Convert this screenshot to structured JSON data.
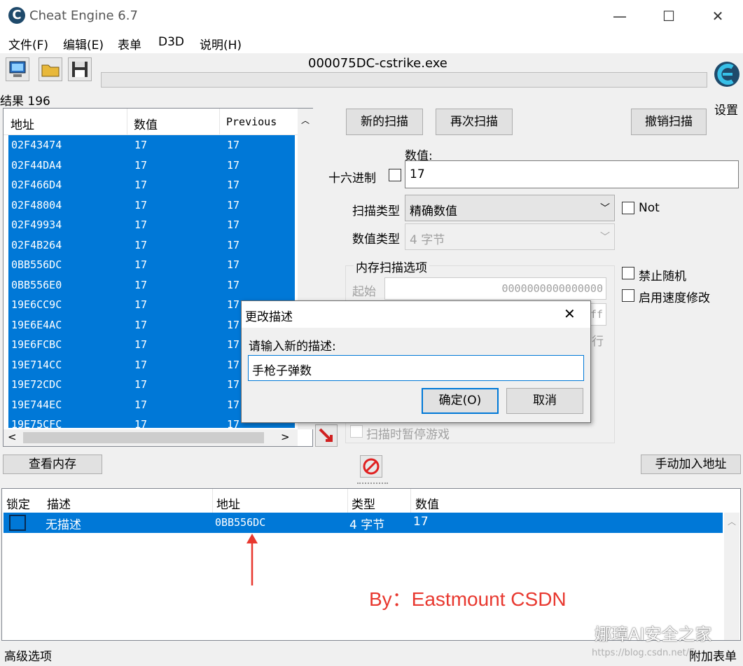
{
  "window": {
    "title": "Cheat Engine 6.7",
    "minimize": "—",
    "maximize": "☐",
    "close": "✕"
  },
  "menu": [
    "文件(F)",
    "编辑(E)",
    "表单",
    "D3D",
    "说明(H)"
  ],
  "process_name": "000075DC-cstrike.exe",
  "settings_label": "设置",
  "results_label": "结果 196",
  "results_table": {
    "headers": [
      "地址",
      "数值",
      "Previous"
    ],
    "rows": [
      [
        "02F43474",
        "17",
        "17"
      ],
      [
        "02F44DA4",
        "17",
        "17"
      ],
      [
        "02F466D4",
        "17",
        "17"
      ],
      [
        "02F48004",
        "17",
        "17"
      ],
      [
        "02F49934",
        "17",
        "17"
      ],
      [
        "02F4B264",
        "17",
        "17"
      ],
      [
        "0BB556DC",
        "17",
        "17"
      ],
      [
        "0BB556E0",
        "17",
        "17"
      ],
      [
        "19E6CC9C",
        "17",
        "17"
      ],
      [
        "19E6E4AC",
        "17",
        "17"
      ],
      [
        "19E6FCBC",
        "17",
        "17"
      ],
      [
        "19E714CC",
        "17",
        "17"
      ],
      [
        "19E72CDC",
        "17",
        "17"
      ],
      [
        "19E744EC",
        "17",
        "17"
      ],
      [
        "19E75CFC",
        "17",
        "17"
      ]
    ]
  },
  "scan": {
    "new_scan": "新的扫描",
    "next_scan": "再次扫描",
    "undo_scan": "撤销扫描",
    "value_label": "数值:",
    "hex_label": "十六进制",
    "value": "17",
    "scan_type_label": "扫描类型",
    "scan_type_value": "精确数值",
    "value_type_label": "数值类型",
    "value_type_value": "4 字节",
    "not_label": "Not",
    "mem_options_label": "内存扫描选项",
    "start_label": "起始",
    "start_value": "0000000000000000",
    "stop_value_partial": "ff",
    "exec_partial": "行",
    "disable_random": "禁止随机",
    "enable_speedhack": "启用速度修改",
    "pause_game": "扫描时暂停游戏"
  },
  "view_memory": "查看内存",
  "add_address_manually": "手动加入地址",
  "address_list": {
    "headers": [
      "锁定",
      "描述",
      "地址",
      "类型",
      "数值"
    ],
    "rows": [
      {
        "description": "无描述",
        "address": "0BB556DC",
        "type": "4 字节",
        "value": "17"
      }
    ]
  },
  "dialog": {
    "title": "更改描述",
    "prompt": "请输入新的描述:",
    "input_value": "手枪子弹数",
    "ok": "确定(O)",
    "cancel": "取消"
  },
  "annotation": "By：Eastmount CSDN",
  "watermark": "娜璋AI安全之家",
  "watermark_url": "https://blog.csdn.net/E",
  "footer": {
    "advanced": "高级选项",
    "table_extras": "附加表单"
  },
  "colors": {
    "selection": "#0078d7",
    "annotation": "#e8382f"
  }
}
